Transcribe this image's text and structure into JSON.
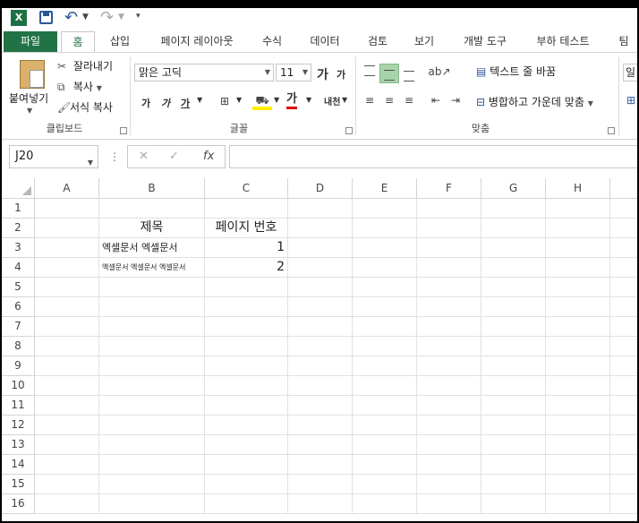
{
  "qat": {
    "app_icon": "X"
  },
  "tabs": [
    "파일",
    "홈",
    "삽입",
    "페이지 레이아웃",
    "수식",
    "데이터",
    "검토",
    "보기",
    "개발 도구",
    "부하 테스트",
    "팀"
  ],
  "ribbon": {
    "clipboard": {
      "paste": "붙여넣기",
      "cut": "잘라내기",
      "copy": "복사",
      "format_painter": "서식 복사",
      "group_label": "클립보드"
    },
    "font": {
      "name": "맑은 고딕",
      "size": "11",
      "grow": "가",
      "shrink": "가",
      "bold": "가",
      "italic": "가",
      "underline": "가",
      "font_color_letter": "가",
      "phonetic": "내천",
      "group_label": "글꼴"
    },
    "alignment": {
      "wrap_text": "텍스트 줄 바꿈",
      "merge_center": "병합하고 가운데 맞춤",
      "group_label": "맞춤"
    },
    "number_partial": "일"
  },
  "formula_bar": {
    "name_box": "J20",
    "fx": "fx",
    "value": ""
  },
  "columns": [
    "A",
    "B",
    "C",
    "D",
    "E",
    "F",
    "G",
    "H"
  ],
  "rows": [
    "1",
    "2",
    "3",
    "4",
    "5",
    "6",
    "7",
    "8",
    "9",
    "10",
    "11",
    "12",
    "13",
    "14",
    "15",
    "16"
  ],
  "cells": {
    "B2": "제목",
    "C2": "페이지 번호",
    "B3": "엑셀문서 엑셀문서",
    "C3": "1",
    "B4": "엑셀문서 엑셀문서 엑셀문서",
    "C4": "2"
  },
  "colors": {
    "file_tab": "#217346",
    "selected_align": "#a9d3ab"
  }
}
